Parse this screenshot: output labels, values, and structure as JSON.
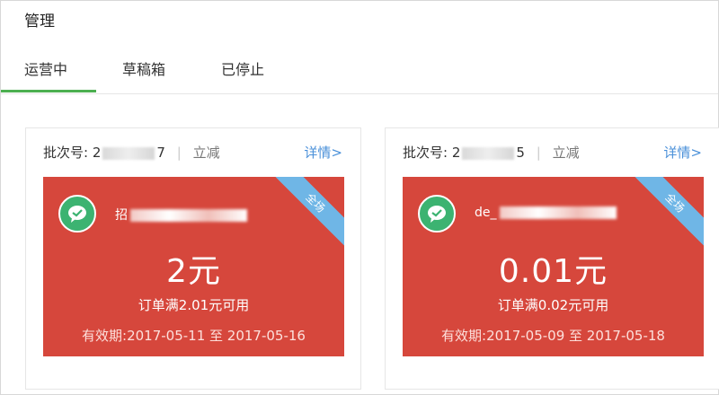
{
  "header": {
    "title": "管理"
  },
  "tabs": [
    {
      "label": "运营中",
      "active": true
    },
    {
      "label": "草稿箱",
      "active": false
    },
    {
      "label": "已停止",
      "active": false
    }
  ],
  "colors": {
    "accent": "#4caf50",
    "coupon_red": "#d6473c",
    "link_blue": "#4a90d9",
    "ribbon_blue": "#6fb6e6",
    "wechat_green": "#3cb371"
  },
  "cards": [
    {
      "batch_label": "批次号:",
      "batch_prefix": "2",
      "batch_suffix": "7",
      "type": "立减",
      "detail_link": "详情>",
      "ribbon": "全场",
      "logo_icon": "wechat-pay-icon",
      "merchant_prefix": "招",
      "amount": "2元",
      "condition": "订单满2.01元可用",
      "validity": "有效期:2017-05-11 至 2017-05-16"
    },
    {
      "batch_label": "批次号:",
      "batch_prefix": "2",
      "batch_suffix": "5",
      "type": "立减",
      "detail_link": "详情>",
      "ribbon": "全场",
      "logo_icon": "wechat-pay-icon",
      "merchant_prefix": "de_",
      "amount": "0.01元",
      "condition": "订单满0.02元可用",
      "validity": "有效期:2017-05-09 至 2017-05-18"
    }
  ]
}
